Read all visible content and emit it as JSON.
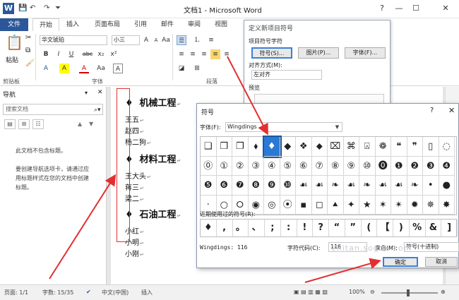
{
  "app": {
    "title": "文档1 - Microsoft Word",
    "word_icon": "W",
    "window_controls": [
      "?",
      "—",
      "☐",
      "✕"
    ]
  },
  "ribbon_tabs": [
    "文件",
    "开始",
    "插入",
    "页面布局",
    "引用",
    "邮件",
    "审阅",
    "视图"
  ],
  "ribbon": {
    "paste_label": "粘贴",
    "clipboard_label": "剪贴板",
    "font_group_label": "字体",
    "paragraph_group_label": "段落",
    "font_name": "华文琥珀",
    "font_size": "小三",
    "font_buttons": [
      "B",
      "I",
      "U",
      "abc",
      "x₂",
      "x²"
    ],
    "font_buttons2": [
      "A",
      "A",
      "Aa",
      "A",
      "A"
    ],
    "size_buttons": [
      "A",
      "A",
      "Aa"
    ]
  },
  "nav": {
    "title": "导航",
    "search_placeholder": "搜索文档",
    "msg1": "此文档不包含标题。",
    "msg2": "要创建导航选项卡，请通过应用标题样式在您的文档中创建标题。"
  },
  "document": {
    "sections": [
      {
        "bullet": "♦",
        "heading": "机械工程",
        "names": [
          "王五",
          "赵四",
          "杨二狗"
        ]
      },
      {
        "bullet": "♦",
        "heading": "材料工程",
        "names": [
          "王大头",
          "蒋三",
          "梁二"
        ]
      },
      {
        "bullet": "♦",
        "heading": "石油工程",
        "names": [
          "小红",
          "小明",
          "小刚"
        ]
      }
    ],
    "para_mark": "↵"
  },
  "define_bullet_dialog": {
    "title": "定义新项目符号",
    "section_label": "项目符号字符",
    "symbol_button": "符号(S)...",
    "picture_button": "图片(P)...",
    "font_button": "字体(F)...",
    "align_label": "对齐方式(M):",
    "align_value": "左对齐",
    "preview_label": "预览"
  },
  "symbol_dialog": {
    "title": "符号",
    "help": "?",
    "close": "✕",
    "font_label": "字体(F):",
    "font_value": "Wingdings",
    "grid": [
      [
        "❑",
        "❒",
        "❐",
        "⬧",
        "♦",
        "◆",
        "❖",
        "⬥",
        "⌧",
        "⌘",
        "⍓",
        "❁",
        "❝",
        "❞",
        "▯",
        "◌"
      ],
      [
        "⓪",
        "①",
        "②",
        "③",
        "④",
        "⑤",
        "⑥",
        "⑦",
        "⑧",
        "⑨",
        "⑩",
        "⓿",
        "❶",
        "❷",
        "❸",
        "❹"
      ],
      [
        "❺",
        "❻",
        "❼",
        "❽",
        "❾",
        "❿",
        "☙",
        "☙",
        "❧",
        "☙",
        "❧",
        "☙",
        "☙",
        "❧",
        "•",
        "●"
      ],
      [
        "·",
        "○",
        "⭘",
        "◉",
        "◎",
        "⦿",
        "▪",
        "◻",
        "⯅",
        "✦",
        "★",
        "✶",
        "✴",
        "✹",
        "✵",
        "✸"
      ]
    ],
    "selected_row": 0,
    "selected_col": 4,
    "recent_label": "近期使用过的符号(R):",
    "recent": [
      "♦",
      ",",
      "。",
      "、",
      ";",
      ":",
      "!",
      "?",
      "“",
      "”",
      "(",
      "【",
      ")",
      "%",
      "&",
      "]"
    ],
    "font_name_status": "Wingdings: 116",
    "code_label": "字符代码(C):",
    "code_value": "116",
    "from_label": "来自(M):",
    "from_value": "符号(十进制)",
    "ok": "确定",
    "cancel": "取消"
  },
  "status": {
    "page": "页面: 1/1",
    "words": "字数: 15/35",
    "language": "中文(中国)",
    "mode": "插入",
    "zoom": "100%"
  },
  "watermark": "zhitan.sogou.com",
  "colors": {
    "accent": "#2b579a",
    "selection": "#2a7ad5",
    "annotation": "#e23030"
  }
}
